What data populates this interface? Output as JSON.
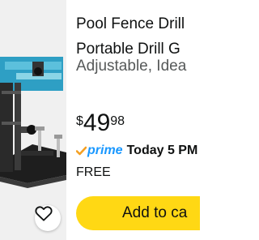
{
  "product": {
    "title_line1": "Pool Fence Drill",
    "title_line2": "Portable Drill G",
    "subtitle": "Adjustable, Idea",
    "price_currency": "$",
    "price_whole": "49",
    "price_fraction": "98",
    "prime_label": "prime",
    "delivery": "Today 5 PM",
    "shipping": "FREE",
    "add_to_cart_label": "Add to ca"
  },
  "icons": {
    "favorite": "heart-outline-icon",
    "prime_check": "prime-check-icon"
  },
  "colors": {
    "accent_button": "#ffd814",
    "prime_blue": "#1a98ff",
    "check_orange": "#f4a023",
    "secondary_text": "#565959",
    "image_background": "#f0f0f0"
  }
}
